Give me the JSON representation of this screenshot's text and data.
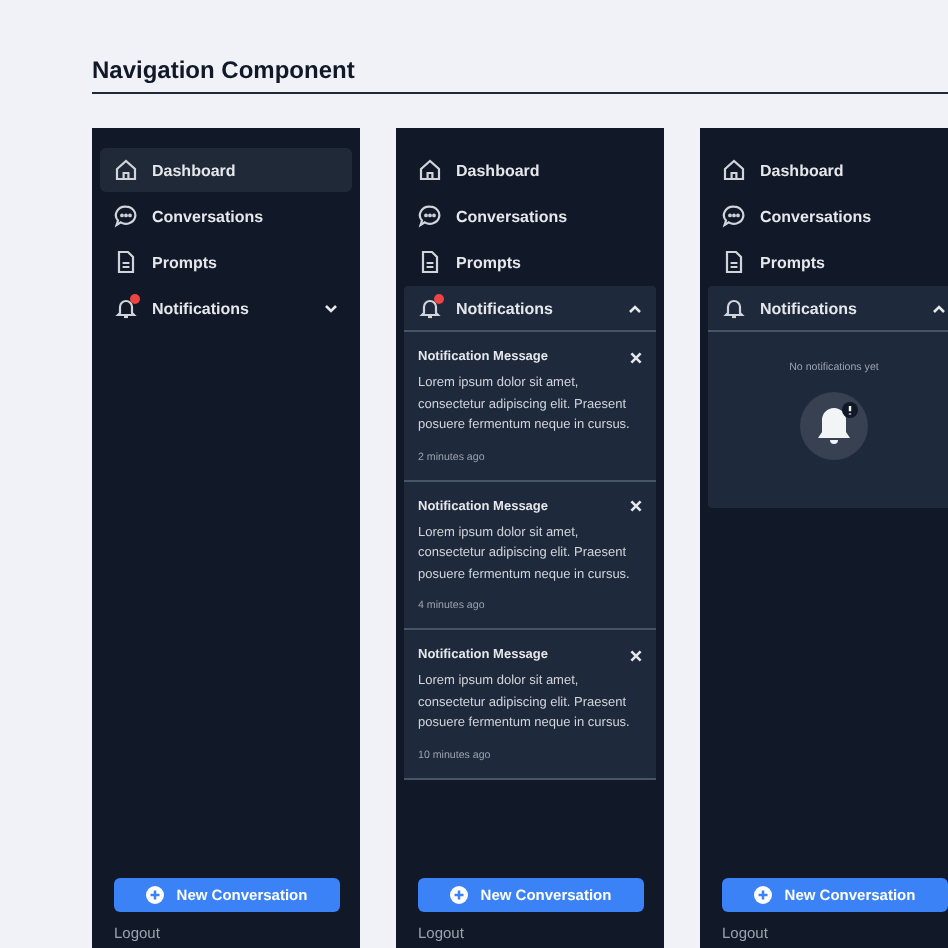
{
  "title": "Navigation Component",
  "panels": [
    {
      "items": [
        {
          "label": "Dashboard",
          "selected": true
        },
        {
          "label": "Conversations",
          "selected": false
        },
        {
          "label": "Prompts",
          "selected": false
        }
      ],
      "notifications": {
        "label": "Notifications",
        "badge": true,
        "expanded": false
      },
      "button": "New Conversation",
      "logout": "Logout"
    },
    {
      "items": [
        {
          "label": "Dashboard",
          "selected": false
        },
        {
          "label": "Conversations",
          "selected": false
        },
        {
          "label": "Prompts",
          "selected": false
        }
      ],
      "notifications": {
        "label": "Notifications",
        "badge": true,
        "expanded": true,
        "messages": [
          {
            "title": "Notification Message",
            "body": "Lorem ipsum dolor sit amet, consectetur adipiscing elit. Praesent posuere fermentum neque in cursus.",
            "time": "2 minutes ago"
          },
          {
            "title": "Notification Message",
            "body": "Lorem ipsum dolor sit amet, consectetur adipiscing elit. Praesent posuere fermentum neque in cursus.",
            "time": "4 minutes ago"
          },
          {
            "title": "Notification Message",
            "body": "Lorem ipsum dolor sit amet, consectetur adipiscing elit. Praesent posuere fermentum neque in cursus.",
            "time": "10 minutes ago"
          }
        ]
      },
      "button": "New Conversation",
      "logout": "Logout"
    },
    {
      "items": [
        {
          "label": "Dashboard",
          "selected": false
        },
        {
          "label": "Conversations",
          "selected": false
        },
        {
          "label": "Prompts",
          "selected": false
        }
      ],
      "notifications": {
        "label": "Notifications",
        "badge": false,
        "expanded": true,
        "empty_text": "No notifications yet"
      },
      "button": "New Conversation",
      "logout": "Logout"
    }
  ]
}
